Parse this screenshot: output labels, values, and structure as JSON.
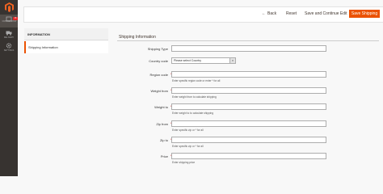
{
  "menu": {
    "notification_count": "16",
    "shop_label": "CUSTOM SHOP",
    "items": [
      {
        "label": "DELIVERY",
        "icon": "truck-icon"
      },
      {
        "label": "SETTINGS",
        "icon": "gear-icon"
      }
    ]
  },
  "actions": {
    "back": "Back",
    "reset": "Reset",
    "save_continue": "Save and Continue Edit",
    "save": "Save Shipping"
  },
  "tabs": {
    "header": "INFORMATION",
    "items": [
      "Shipping Information"
    ]
  },
  "form": {
    "section_title": "Shipping Information",
    "fields": {
      "shipping_type": {
        "label": "Shipping Type",
        "value": ""
      },
      "country_code": {
        "label": "Country code",
        "value": "Please select Country"
      },
      "region_code": {
        "label": "Region code",
        "value": "",
        "note": "Enter specific region code or enter * for all"
      },
      "weight_from": {
        "label": "Weight from",
        "value": "",
        "note": "Enter weight from to calculate shipping"
      },
      "weight_to": {
        "label": "Weight to",
        "value": "",
        "note": "Enter weight to to calculate shipping"
      },
      "zip_from": {
        "label": "Zip from",
        "value": "",
        "note": "Enter specific zip or * for all"
      },
      "zip_to": {
        "label": "Zip to",
        "value": "",
        "note": "Enter specific zip or * for all"
      },
      "price": {
        "label": "Price",
        "value": "",
        "note": "Enter shipping price"
      }
    },
    "required_marker": "*"
  },
  "colors": {
    "accent": "#eb5202",
    "sidebar": "#373330"
  }
}
